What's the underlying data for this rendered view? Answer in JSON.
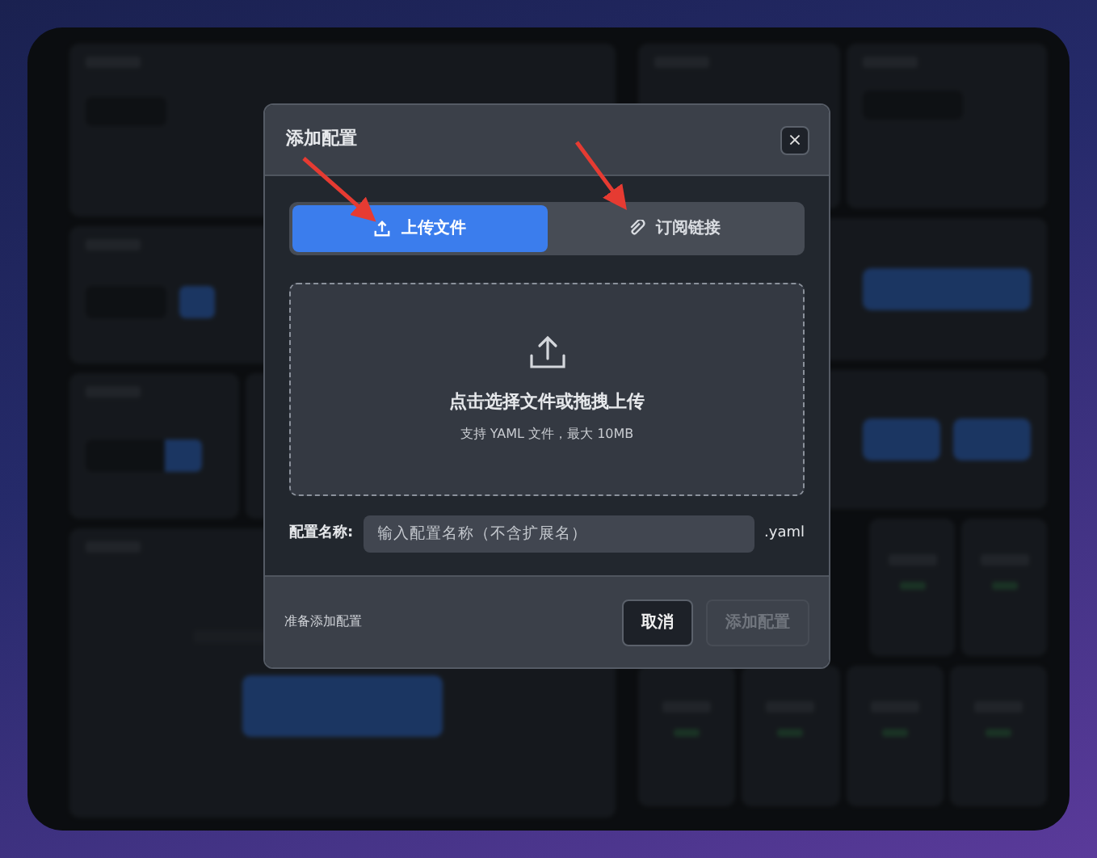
{
  "modal": {
    "title": "添加配置",
    "close": "×",
    "tabs": [
      {
        "label": "上传文件",
        "selected": true
      },
      {
        "label": "订阅链接",
        "selected": false
      }
    ],
    "dropzone": {
      "title": "点击选择文件或拖拽上传",
      "hint": "支持 YAML 文件，最大 10MB"
    },
    "name_field": {
      "label": "配置名称:",
      "placeholder": "输入配置名称（不含扩展名）",
      "suffix": ".yaml"
    },
    "status": "准备添加配置",
    "buttons": [
      {
        "label": "取消",
        "disabled": false
      },
      {
        "label": "添加配置",
        "disabled": true
      }
    ]
  }
}
